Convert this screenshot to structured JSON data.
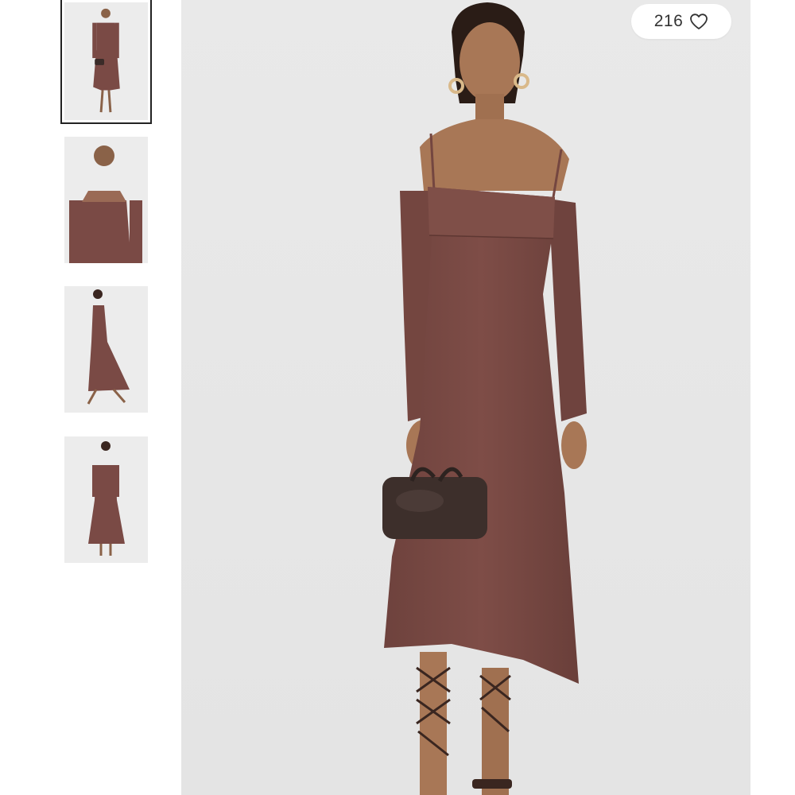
{
  "gallery": {
    "thumbnails": [
      {
        "view": "front-full",
        "selected": true
      },
      {
        "view": "front-closeup",
        "selected": false
      },
      {
        "view": "side-walking",
        "selected": false
      },
      {
        "view": "back-full",
        "selected": false
      }
    ],
    "main_image": {
      "view": "front-full"
    }
  },
  "like": {
    "count": "216",
    "icon": "heart-outline-icon"
  },
  "colors": {
    "dress": "#7a4a45",
    "background": "#ebebeb",
    "selected_border": "#222222"
  }
}
